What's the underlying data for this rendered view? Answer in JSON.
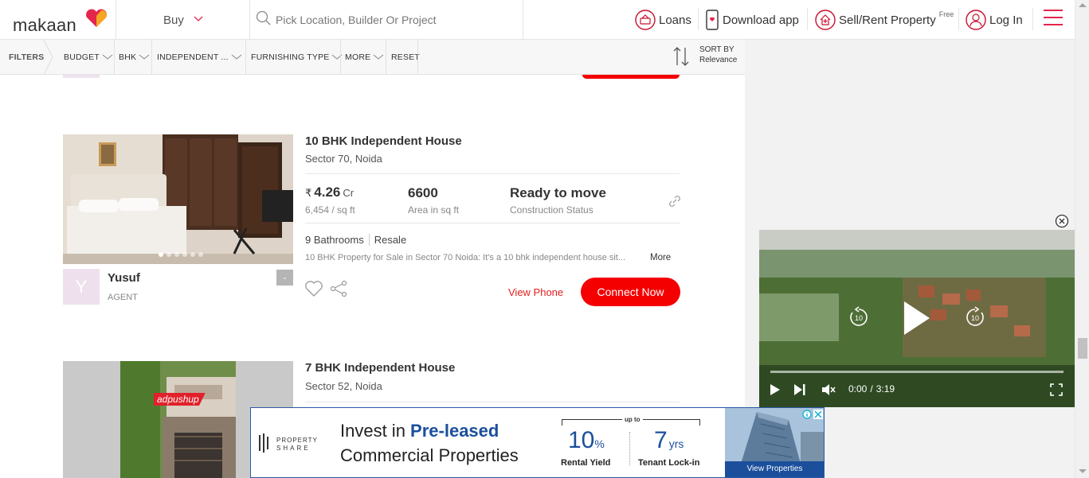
{
  "header": {
    "logo_text": "makaan",
    "buy_label": "Buy",
    "search_placeholder": "Pick Location, Builder Or Project",
    "loans_label": "Loans",
    "download_label": "Download app",
    "sell_label": "Sell/Rent Property",
    "sell_badge": "Free",
    "login_label": "Log In"
  },
  "filters": {
    "filters_label": "FILTERS",
    "items": [
      "BUDGET",
      "BHK",
      "INDEPENDENT ...",
      "FURNISHING TYPE",
      "MORE",
      "RESET"
    ],
    "sort_by": "SORT BY",
    "sort_value": "Relevance"
  },
  "listings": [
    {
      "title": "10 BHK Independent House",
      "location": "Sector 70, Noida",
      "price_symbol": "₹",
      "price": "4.26",
      "price_unit": "Cr",
      "price_per_sqft": "6,454 / sq ft",
      "area": "6600",
      "area_label": "Area in sq ft",
      "status": "Ready to move",
      "status_label": "Construction Status",
      "bathrooms": "9 Bathrooms",
      "sale_type": "Resale",
      "description": "10 BHK Property for Sale in Sector 70 Noida: It's a 10 bhk independent house sit...",
      "more_label": "More",
      "agent_initial": "Y",
      "agent_name": "Yusuf",
      "agent_role": "AGENT",
      "agent_badge": "-",
      "view_phone": "View Phone",
      "connect": "Connect Now"
    },
    {
      "title": "7 BHK Independent House",
      "location": "Sector 52, Noida",
      "image_tag": "adpushup"
    }
  ],
  "video": {
    "current_time": "0:00",
    "separator": "/",
    "duration": "3:19",
    "skip_seconds": "10"
  },
  "ad": {
    "brand_line1": "PROPERTY",
    "brand_line2": "SHARE",
    "headline_prefix": "Invest in ",
    "headline_highlight": "Pre-leased",
    "headline_line2": "Commercial Properties",
    "upto_label": "up to",
    "yield_value": "10",
    "yield_unit": "%",
    "yield_label": "Rental Yield",
    "lock_value": "7",
    "lock_unit": "yrs",
    "lock_label": "Tenant Lock-in",
    "cta": "View Properties"
  },
  "colors": {
    "brand_red": "#f40000",
    "accent_pink": "#e4264c",
    "ad_blue": "#1b4f9c"
  }
}
